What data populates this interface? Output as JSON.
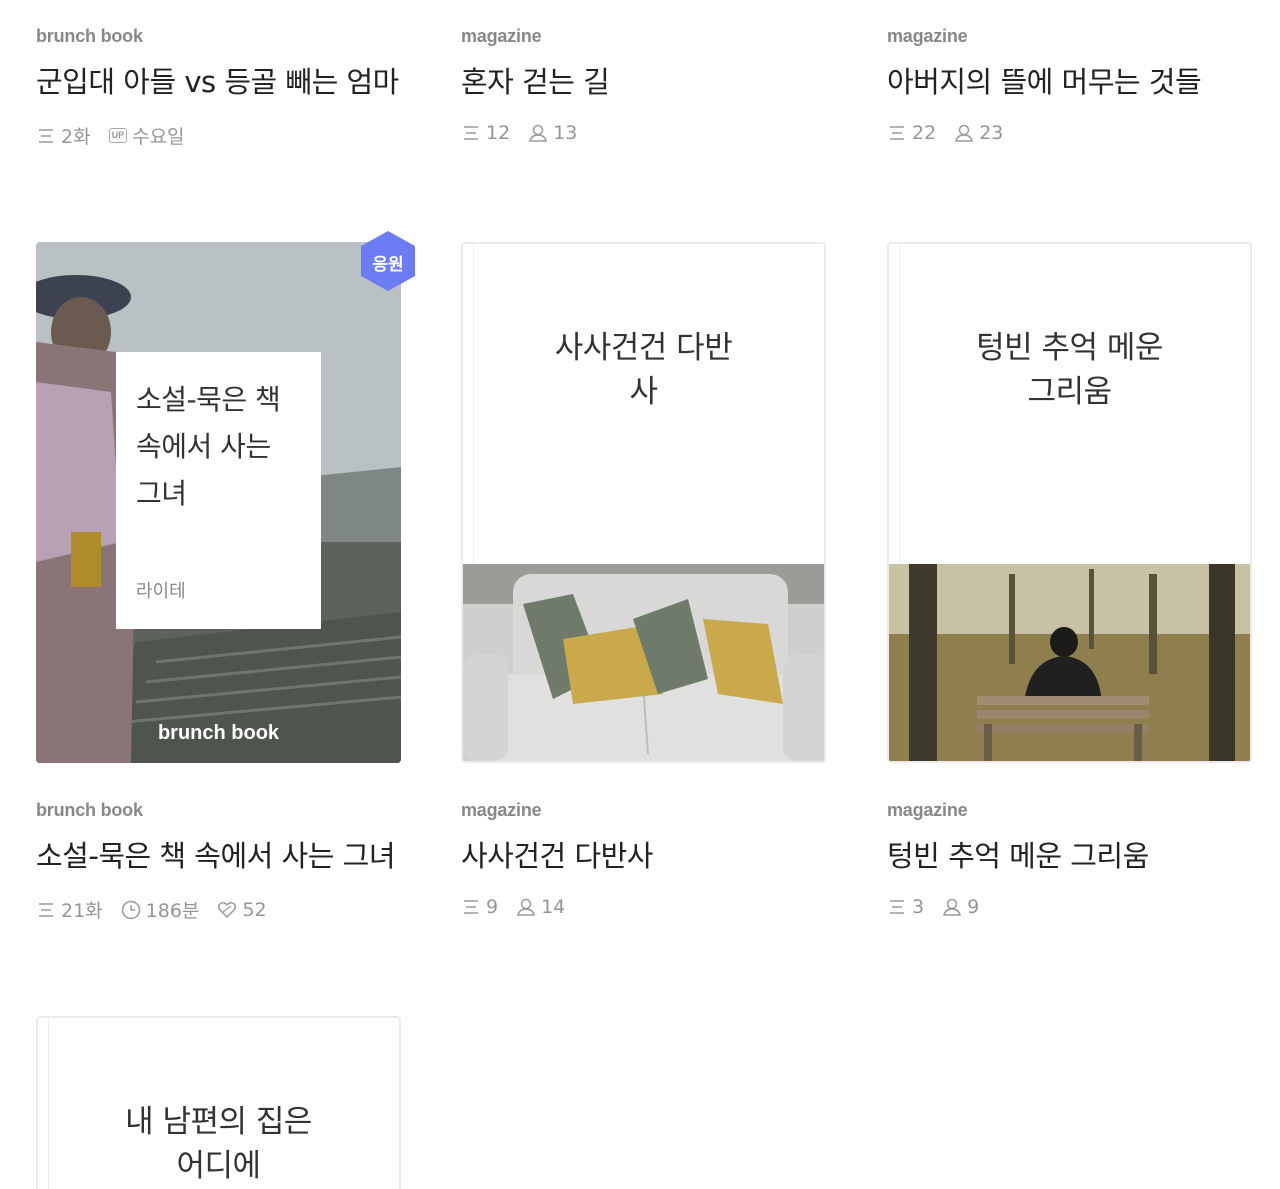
{
  "row1": [
    {
      "type": "brunch book",
      "title": "군입대 아들 vs 등골 빼는 엄마",
      "stat1": "2화",
      "stat2_badge": "UP",
      "stat2": "수요일"
    },
    {
      "type": "magazine",
      "title": "혼자 걷는 길",
      "stat1": "12",
      "stat2": "13"
    },
    {
      "type": "magazine",
      "title": "아버지의 뜰에 머무는 것들",
      "stat1": "22",
      "stat2": "23"
    }
  ],
  "covers": [
    {
      "badge": "응원",
      "card_title": "소설-묵은 책 속에서 사는 그녀",
      "author": "라이테",
      "mark": "brunch book"
    },
    {
      "title": "사사건건 다반사"
    },
    {
      "title": "텅빈 추억 메운 그리움"
    }
  ],
  "row2": [
    {
      "type": "brunch book",
      "title": "소설-묵은 책 속에서 사는 그녀",
      "stat1": "21화",
      "stat2": "186분",
      "stat3": "52"
    },
    {
      "type": "magazine",
      "title": "사사건건 다반사",
      "stat1": "9",
      "stat2": "14"
    },
    {
      "type": "magazine",
      "title": "텅빈 추억 메운 그리움",
      "stat1": "3",
      "stat2": "9"
    }
  ],
  "row3": [
    {
      "title": "내 남편의 집은 어디에"
    }
  ],
  "icons": {
    "list": "list-icon",
    "subscriber": "person-icon",
    "clock": "clock-icon",
    "like": "heart-icon",
    "update": "up-badge-icon"
  },
  "colors": {
    "support_badge": "#6c7cf5",
    "muted_text": "#959595",
    "type_label": "#888888"
  }
}
